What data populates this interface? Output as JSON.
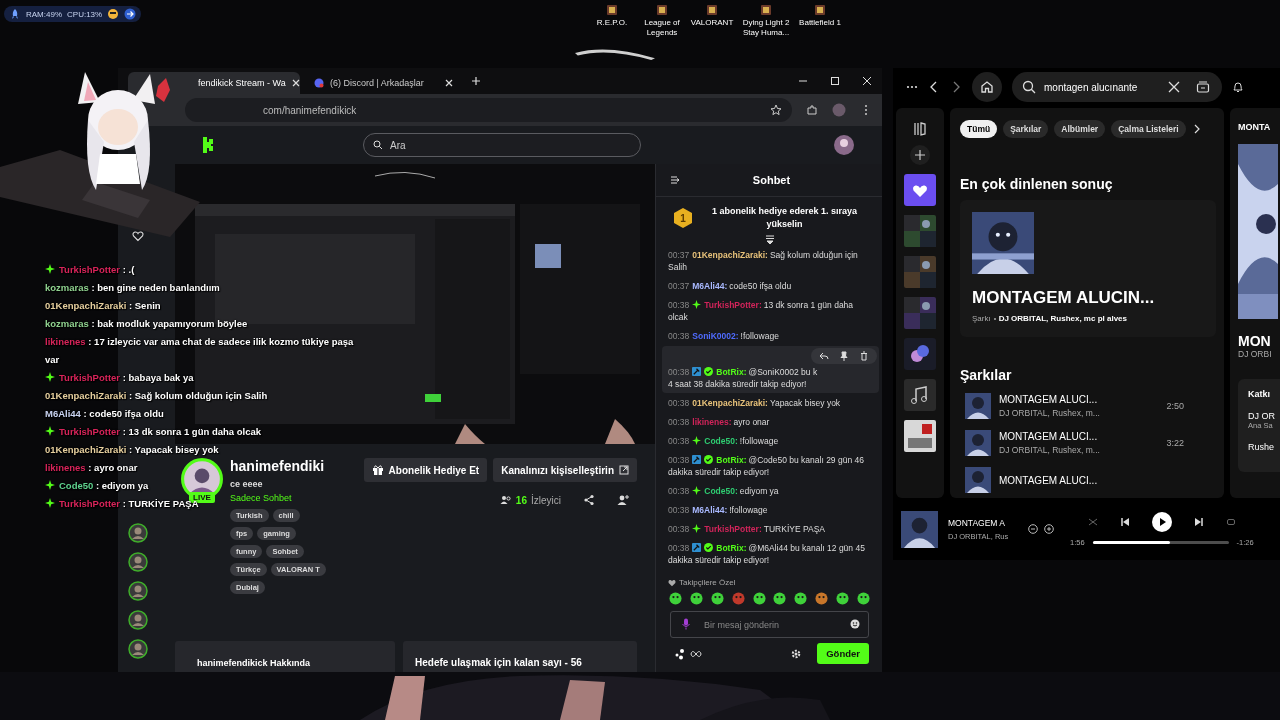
{
  "system_monitor": {
    "ram": "RAM:49%",
    "cpu": "CPU:13%"
  },
  "desktop_icons": [
    {
      "label": "R.E.P.O."
    },
    {
      "label": "League of Legends"
    },
    {
      "label": "VALORANT"
    },
    {
      "label": "Dying Light 2 Stay Huma..."
    },
    {
      "label": "Battlefield 1"
    }
  ],
  "overlay_chat": [
    {
      "user": "TurkishPotter",
      "badge": true,
      "color": "#d8245a",
      "text": ": .("
    },
    {
      "user": "kozmaras",
      "badge": false,
      "color": "#8fd18f",
      "text": ": ben gine neden banlandıım"
    },
    {
      "user": "01KenpachiZaraki",
      "badge": false,
      "color": "#e6cf9e",
      "text": ": Senin"
    },
    {
      "user": "kozmaras",
      "badge": false,
      "color": "#8fd18f",
      "text": ": bak modluk yapamıyorum böylee"
    },
    {
      "user": "likinenes",
      "badge": false,
      "color": "#d8245a",
      "text": ": 17 izleycic var ama chat de sadece ilik kozmo tükiye paşa var"
    },
    {
      "user": "TurkishPotter",
      "badge": true,
      "color": "#d8245a",
      "text": ": babaya bak ya"
    },
    {
      "user": "01KenpachiZaraki",
      "badge": false,
      "color": "#e6cf9e",
      "text": ": Sağ kolum olduğun için Salih"
    },
    {
      "user": "M6Ali44",
      "badge": false,
      "color": "#c8d2f0",
      "text": ": code50 ifşa oldu"
    },
    {
      "user": "TurkishPotter",
      "badge": true,
      "color": "#d8245a",
      "text": ": 13 dk sonra 1 gün daha olcak"
    },
    {
      "user": "01KenpachiZaraki",
      "badge": false,
      "color": "#e6cf9e",
      "text": ": Yapacak bisey yok"
    },
    {
      "user": "likinenes",
      "badge": false,
      "color": "#d8245a",
      "text": ": ayro onar"
    },
    {
      "user": "Code50",
      "badge": true,
      "color": "#5fd38f",
      "text": ": ediyom ya"
    },
    {
      "user": "TurkishPotter",
      "badge": true,
      "color": "#d8245a",
      "text": ": TURKİYE PAŞA"
    }
  ],
  "browser": {
    "tabs": [
      {
        "title": "fendikick Stream - Wa",
        "selected": true
      },
      {
        "title": "(6) Discord | Arkadaşlar",
        "selected": false
      }
    ],
    "address": "com/hanimefendikick"
  },
  "kick": {
    "search": {
      "placeholder": "Ara"
    },
    "streamer": {
      "name": "hanimefendiki",
      "title": "ce eeee",
      "category": "Sadece Sohbet",
      "live_badge": "LIVE",
      "viewers": "16",
      "viewers_label": "İzleyici"
    },
    "tags": [
      "Turkish",
      "chill",
      "fps",
      "gaming",
      "funny",
      "Sohbet",
      "Türkçe",
      "VALORAN T",
      "Dublaj"
    ],
    "buttons": [
      {
        "label": "Abonelik Hediye Et",
        "kind": "gift"
      },
      {
        "label": "Kanalınızı kişiselleştirin",
        "kind": "external"
      }
    ],
    "cards": [
      "hanimefendikick Hakkında",
      "Hedefe ulaşmak için kalan sayı - 56"
    ]
  },
  "chat": {
    "title": "Sohbet",
    "rank": "1",
    "banner": "1 abonelik hediye ederek 1. sıraya yükselin",
    "messages": [
      {
        "time": "00:37",
        "user": "01KenpachiZaraki:",
        "color": "#e8c27a",
        "text": "Sağ kolum olduğun için Salih",
        "hovered": false
      },
      {
        "time": "00:37",
        "user": "M6Ali44:",
        "color": "#a9b9ff",
        "text": "code50 ifşa oldu",
        "hovered": false
      },
      {
        "time": "00:38",
        "badges": [
          {
            "kind": "sparkle"
          }
        ],
        "user": "TurkishPotter:",
        "color": "#d0245a",
        "text": "13 dk sonra 1 gün daha olcak",
        "hovered": false
      },
      {
        "time": "00:38",
        "user": "SoniK0002:",
        "color": "#4f6bff",
        "text": "!followage",
        "hovered": false
      },
      {
        "time": "00:38",
        "badges": [
          {
            "kind": "mod"
          },
          {
            "kind": "verified"
          }
        ],
        "user": "BotRix:",
        "color": "#53fc18",
        "text": "@SoniK0002 bu k",
        "text_2": "4 saat 38 dakika süredir takip ediyor!",
        "hovered": true
      },
      {
        "time": "00:38",
        "user": "01KenpachiZaraki:",
        "color": "#e8c27a",
        "text": "Yapacak bisey yok",
        "hovered": false
      },
      {
        "time": "00:38",
        "user": "likinenes:",
        "color": "#d0245a",
        "text": "ayro onar",
        "hovered": false
      },
      {
        "time": "00:38",
        "badges": [
          {
            "kind": "sparkle"
          }
        ],
        "user": "Code50:",
        "color": "#2ecc71",
        "text": "!followage",
        "hovered": false
      },
      {
        "time": "00:38",
        "badges": [
          {
            "kind": "mod"
          },
          {
            "kind": "verified"
          }
        ],
        "user": "BotRix:",
        "color": "#53fc18",
        "text": "@Code50 bu kanalı 29 gün 46 dakika süredir takip ediyor!",
        "hovered": false
      },
      {
        "time": "00:38",
        "badges": [
          {
            "kind": "sparkle"
          }
        ],
        "user": "Code50:",
        "color": "#2ecc71",
        "text": "ediyom ya",
        "hovered": false
      },
      {
        "time": "00:38",
        "user": "M6Ali44:",
        "color": "#a9b9ff",
        "text": "!followage",
        "hovered": false
      },
      {
        "time": "00:38",
        "badges": [
          {
            "kind": "sparkle"
          }
        ],
        "user": "TurkishPotter:",
        "color": "#d0245a",
        "text": "TURKİYE PAŞA",
        "hovered": false
      },
      {
        "time": "00:38",
        "badges": [
          {
            "kind": "mod"
          },
          {
            "kind": "verified"
          }
        ],
        "user": "BotRix:",
        "color": "#53fc18",
        "text": "@M6Ali44 bu kanalı 12 gün 45 dakika süredir takip ediyor!",
        "hovered": false
      }
    ],
    "followers_label": "Takipçilere Özel",
    "input": {
      "placeholder": "Bir mesaj gönderin"
    },
    "send": "Gönder"
  },
  "spotify": {
    "search": "montagen alucınante",
    "filters": [
      {
        "label": "Tümü",
        "selected": true
      },
      {
        "label": "Şarkılar",
        "selected": false
      },
      {
        "label": "Albümler",
        "selected": false
      },
      {
        "label": "Çalma Listeleri",
        "selected": false
      }
    ],
    "top_heading": "En çok dinlenen sonuç",
    "top_result": {
      "title": "MONTAGEM ALUCIN...",
      "type": "Şarkı",
      "artists": "DJ ORBITAL, Rushex, mc pl alves"
    },
    "songs_heading": "Şarkılar",
    "songs": [
      {
        "title": "MONTAGEM ALUCI...",
        "artists": "DJ ORBITAL, Rushex, m...",
        "duration": "2:50"
      },
      {
        "title": "MONTAGEM ALUCI...",
        "artists": "DJ ORBITAL, Rushex, m...",
        "duration": "3:22"
      },
      {
        "title": "MONTAGEM ALUCI..."
      }
    ],
    "side_panel": {
      "heading": "MONTA",
      "title": "MON",
      "artist": "DJ ORBI",
      "credits": "Katkı",
      "credit_1": "DJ OR",
      "credit_1_role": "Ana Sa",
      "credit_2": "Rushe"
    },
    "player": {
      "title": "MONTAGEM A",
      "artist": "DJ ORBITAL, Rus",
      "elapsed": "1:56",
      "remaining": "-1:26",
      "level": 0.57
    }
  }
}
